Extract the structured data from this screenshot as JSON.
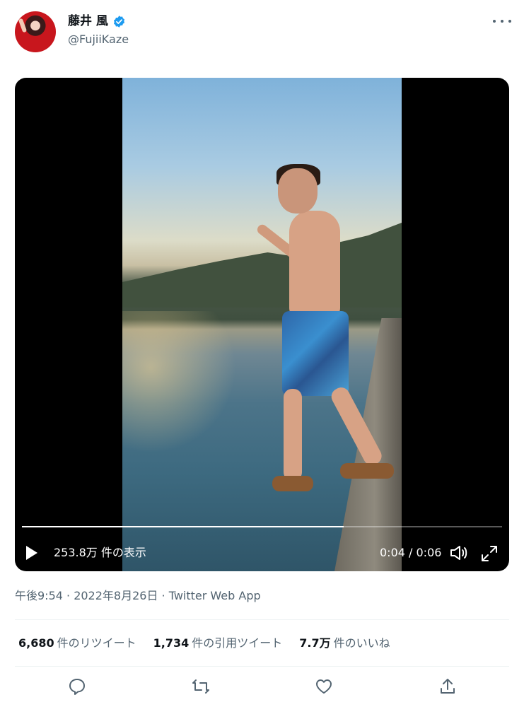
{
  "author": {
    "name": "藤井 風",
    "handle": "@FujiiKaze",
    "verified": true,
    "accent_color": "#1d9bf0"
  },
  "more_icon": "more-horizontal-icon",
  "video": {
    "views": "253.8万 件の表示",
    "time": "0:04 / 0:06",
    "progress": 0.67,
    "icons": [
      "play-icon",
      "volume-icon",
      "fullscreen-icon"
    ]
  },
  "meta": {
    "timestamp": "午後9:54 · 2022年8月26日 · Twitter Web App"
  },
  "stats": {
    "retweets_count": "6,680",
    "retweets_label": "件のリツイート",
    "quotes_count": "1,734",
    "quotes_label": "件の引用ツイート",
    "likes_count": "7.7万",
    "likes_label": "件のいいね"
  },
  "actions": [
    "reply-icon",
    "retweet-icon",
    "like-icon",
    "share-icon"
  ]
}
